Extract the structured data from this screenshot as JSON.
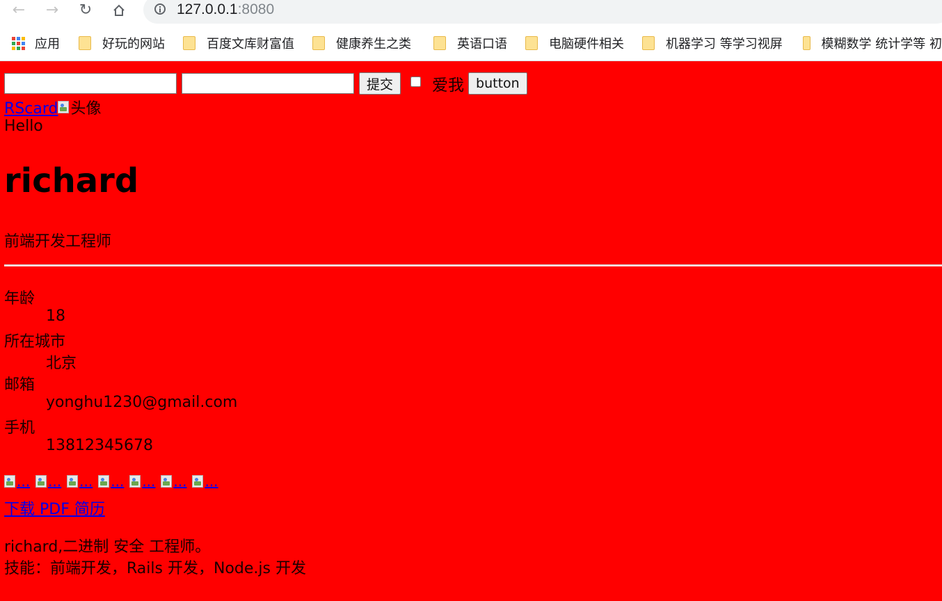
{
  "browser": {
    "url_host": "127.0.0.1",
    "url_port": ":8080",
    "nav": {
      "back_icon": "back-arrow-icon",
      "forward_icon": "forward-arrow-icon",
      "reload_icon": "reload-icon",
      "home_icon": "home-icon",
      "info_icon": "info-icon"
    },
    "bookmarks": [
      {
        "label": "应用",
        "icon": "apps-grid-icon"
      },
      {
        "label": "好玩的网站",
        "icon": "folder-icon"
      },
      {
        "label": "百度文库财富值",
        "icon": "folder-icon"
      },
      {
        "label": "健康养生之类",
        "icon": "folder-icon"
      },
      {
        "label": "英语口语",
        "icon": "folder-icon"
      },
      {
        "label": "电脑硬件相关",
        "icon": "folder-icon"
      },
      {
        "label": "机器学习 等学习视屏",
        "icon": "folder-icon"
      },
      {
        "label": "模糊数学 统计学等 初",
        "icon": "folder-icon"
      }
    ]
  },
  "form": {
    "input1_value": "",
    "input2_value": "",
    "submit_label": "提交",
    "checkbox_checked": false,
    "checkbox_label": "爱我",
    "button_label": "button"
  },
  "header": {
    "logo_link": "RScard",
    "avatar_alt": "头像",
    "greeting": "Hello",
    "name": "richard",
    "title": "前端开发工程师"
  },
  "info": [
    {
      "label": "年龄",
      "value": "18"
    },
    {
      "label": "所在城市",
      "value": "北京"
    },
    {
      "label": "邮箱",
      "value": "yonghu1230@gmail.com"
    },
    {
      "label": "手机",
      "value": "13812345678"
    }
  ],
  "social_icons": [
    "...",
    "...",
    "...",
    "...",
    "...",
    "...",
    "..."
  ],
  "download_link": "下载 PDF 简历",
  "about": {
    "line1": "richard,二进制 安全 工程师。",
    "line2": "技能：前端开发，Rails 开发，Node.js 开发"
  },
  "colors": {
    "page_background": "#ff0000",
    "link": "#0000ee"
  }
}
